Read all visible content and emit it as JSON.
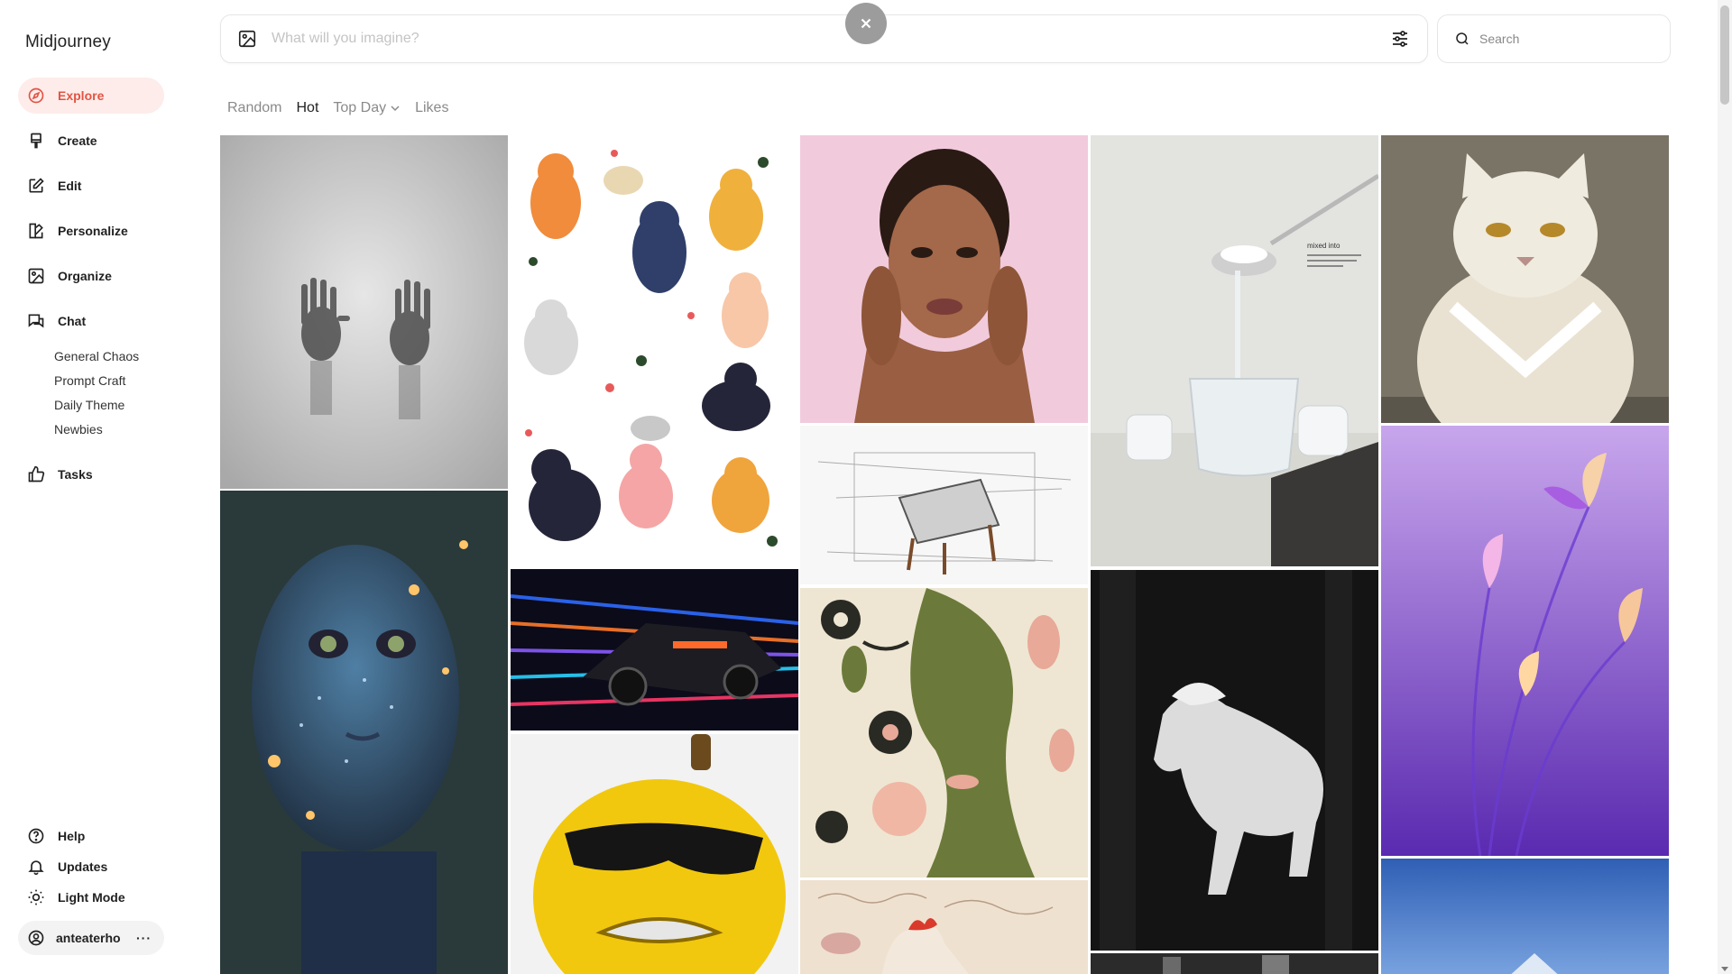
{
  "app": {
    "title": "Midjourney"
  },
  "sidebar": {
    "items": [
      {
        "label": "Explore",
        "icon": "compass-icon",
        "active": true
      },
      {
        "label": "Create",
        "icon": "paintbrush-icon"
      },
      {
        "label": "Edit",
        "icon": "edit-icon"
      },
      {
        "label": "Personalize",
        "icon": "personalize-icon"
      },
      {
        "label": "Organize",
        "icon": "image-icon"
      },
      {
        "label": "Chat",
        "icon": "chat-icon"
      }
    ],
    "chat_rooms": [
      "General Chaos",
      "Prompt Craft",
      "Daily Theme",
      "Newbies"
    ],
    "tasks": {
      "label": "Tasks",
      "icon": "thumbs-up-icon"
    },
    "bottom": [
      {
        "label": "Help",
        "icon": "help-icon"
      },
      {
        "label": "Updates",
        "icon": "bell-icon"
      },
      {
        "label": "Light Mode",
        "icon": "sun-icon"
      }
    ],
    "user": {
      "name": "anteaterho",
      "more": "···"
    }
  },
  "prompt": {
    "placeholder": "What will you imagine?"
  },
  "search": {
    "placeholder": "Search"
  },
  "tabs": [
    {
      "label": "Random",
      "active": false
    },
    {
      "label": "Hot",
      "active": true
    },
    {
      "label": "Top Day",
      "active": false,
      "dropdown": true
    },
    {
      "label": "Likes",
      "active": false
    }
  ],
  "colors": {
    "accent": "#e25544",
    "active_bg": "#fdecea"
  },
  "gallery": [
    {
      "name": "foggy-hands-image"
    },
    {
      "name": "cats-pattern-image"
    },
    {
      "name": "woman-portrait-image"
    },
    {
      "name": "spoon-glass-image",
      "caption": "mixed into"
    },
    {
      "name": "grumpy-cat-image"
    },
    {
      "name": "chair-sketch-image"
    },
    {
      "name": "glowing-alien-image"
    },
    {
      "name": "race-car-image"
    },
    {
      "name": "flower-face-art-image"
    },
    {
      "name": "white-horse-image"
    },
    {
      "name": "purple-flowers-image"
    },
    {
      "name": "angry-lemon-image"
    },
    {
      "name": "rooster-collage-image"
    },
    {
      "name": "dark-bottom-image"
    },
    {
      "name": "blue-sky-image"
    }
  ]
}
